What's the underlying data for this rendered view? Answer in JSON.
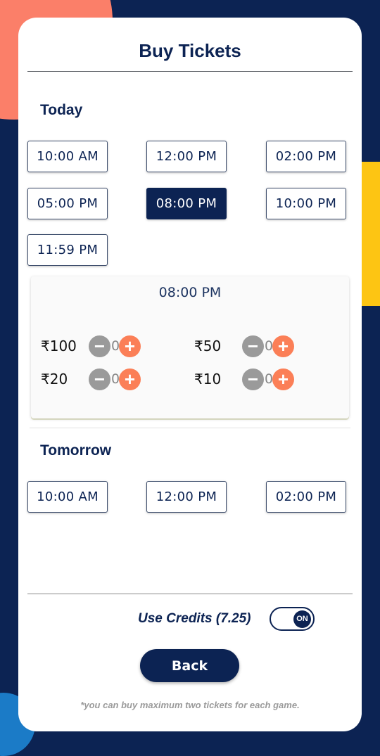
{
  "header": {
    "title": "Buy Tickets"
  },
  "today": {
    "label": "Today",
    "slots": [
      {
        "time": "10:00 AM",
        "selected": false
      },
      {
        "time": "12:00 PM",
        "selected": false
      },
      {
        "time": "02:00 PM",
        "selected": false
      },
      {
        "time": "05:00 PM",
        "selected": false
      },
      {
        "time": "08:00 PM",
        "selected": true
      },
      {
        "time": "10:00 PM",
        "selected": false
      },
      {
        "time": "11:59 PM",
        "selected": false
      }
    ]
  },
  "selected_slot": {
    "time": "08:00 PM",
    "tickets": [
      {
        "price": "₹100",
        "quantity": "0"
      },
      {
        "price": "₹50",
        "quantity": "0"
      },
      {
        "price": "₹20",
        "quantity": "0"
      },
      {
        "price": "₹10",
        "quantity": "0"
      }
    ],
    "minus_icon": "minus-circle-icon",
    "plus_icon": "plus-circle-icon"
  },
  "tomorrow": {
    "label": "Tomorrow",
    "slots": [
      {
        "time": "10:00 AM",
        "selected": false
      },
      {
        "time": "12:00 PM",
        "selected": false
      },
      {
        "time": "02:00 PM",
        "selected": false
      }
    ]
  },
  "credits": {
    "label": "Use Credits (7.25)",
    "toggle_state": "ON",
    "enabled": true
  },
  "actions": {
    "back_label": "Back"
  },
  "footnote": "*you can buy maximum two tickets for each game.",
  "colors": {
    "primary": "#0c2353",
    "accent_coral": "#fb7f69",
    "accent_yellow": "#fdc513",
    "accent_blue": "#1b7bc7",
    "plus_button": "#fb7f57",
    "minus_button": "#9a9a9a"
  }
}
